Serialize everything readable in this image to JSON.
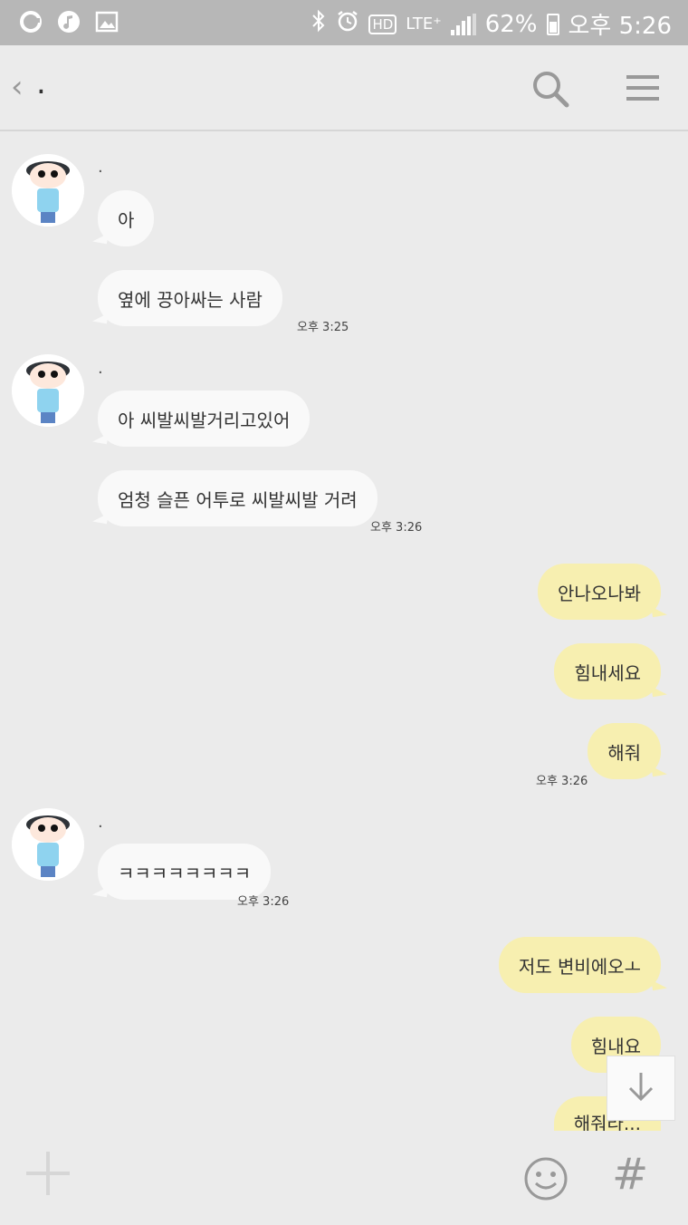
{
  "status_bar": {
    "battery": "62%",
    "time": "오후 5:26",
    "network": "LTE⁺",
    "hd": "HD",
    "icons": [
      "olleh-icon",
      "music-icon",
      "gallery-icon",
      "bluetooth-icon",
      "alarm-icon",
      "hd-icon",
      "lte-icon",
      "signal-icon",
      "battery-icon"
    ]
  },
  "header": {
    "back_glyph": "‹",
    "title": ".",
    "icons": [
      "back-icon",
      "search-icon",
      "menu-icon"
    ]
  },
  "messages": [
    {
      "sender": ".",
      "text": "아"
    },
    {
      "text": "옆에 끙아싸는 사람",
      "time": "오후 3:25"
    },
    {
      "sender": ".",
      "text": "아 씨발씨발거리고있어"
    },
    {
      "text": "엄청 슬픈 어투로 씨발씨발 거려",
      "time": "오후 3:26"
    },
    {
      "text": "안나오나봐"
    },
    {
      "text": "힘내세요"
    },
    {
      "text": "해줘",
      "time": "오후 3:26"
    },
    {
      "sender": ".",
      "text": "ㅋㅋㅋㅋㅋㅋㅋㅋ",
      "time": "오후 3:26"
    },
    {
      "text": "저도 변비에오ㅗ"
    },
    {
      "text": "힘내요"
    },
    {
      "text": "해줘라..."
    }
  ],
  "bottom_bar": {
    "hash_glyph": "#",
    "icons": [
      "plus-icon",
      "emoji-icon",
      "hash-icon"
    ]
  },
  "scroll_down_icon": "arrow-down-icon",
  "colors": {
    "background": "#ebebeb",
    "status_bar": "#b7b7b7",
    "incoming_bubble": "#f9f9f9",
    "outgoing_bubble": "#f7efb0",
    "icon_gray": "#999999"
  }
}
